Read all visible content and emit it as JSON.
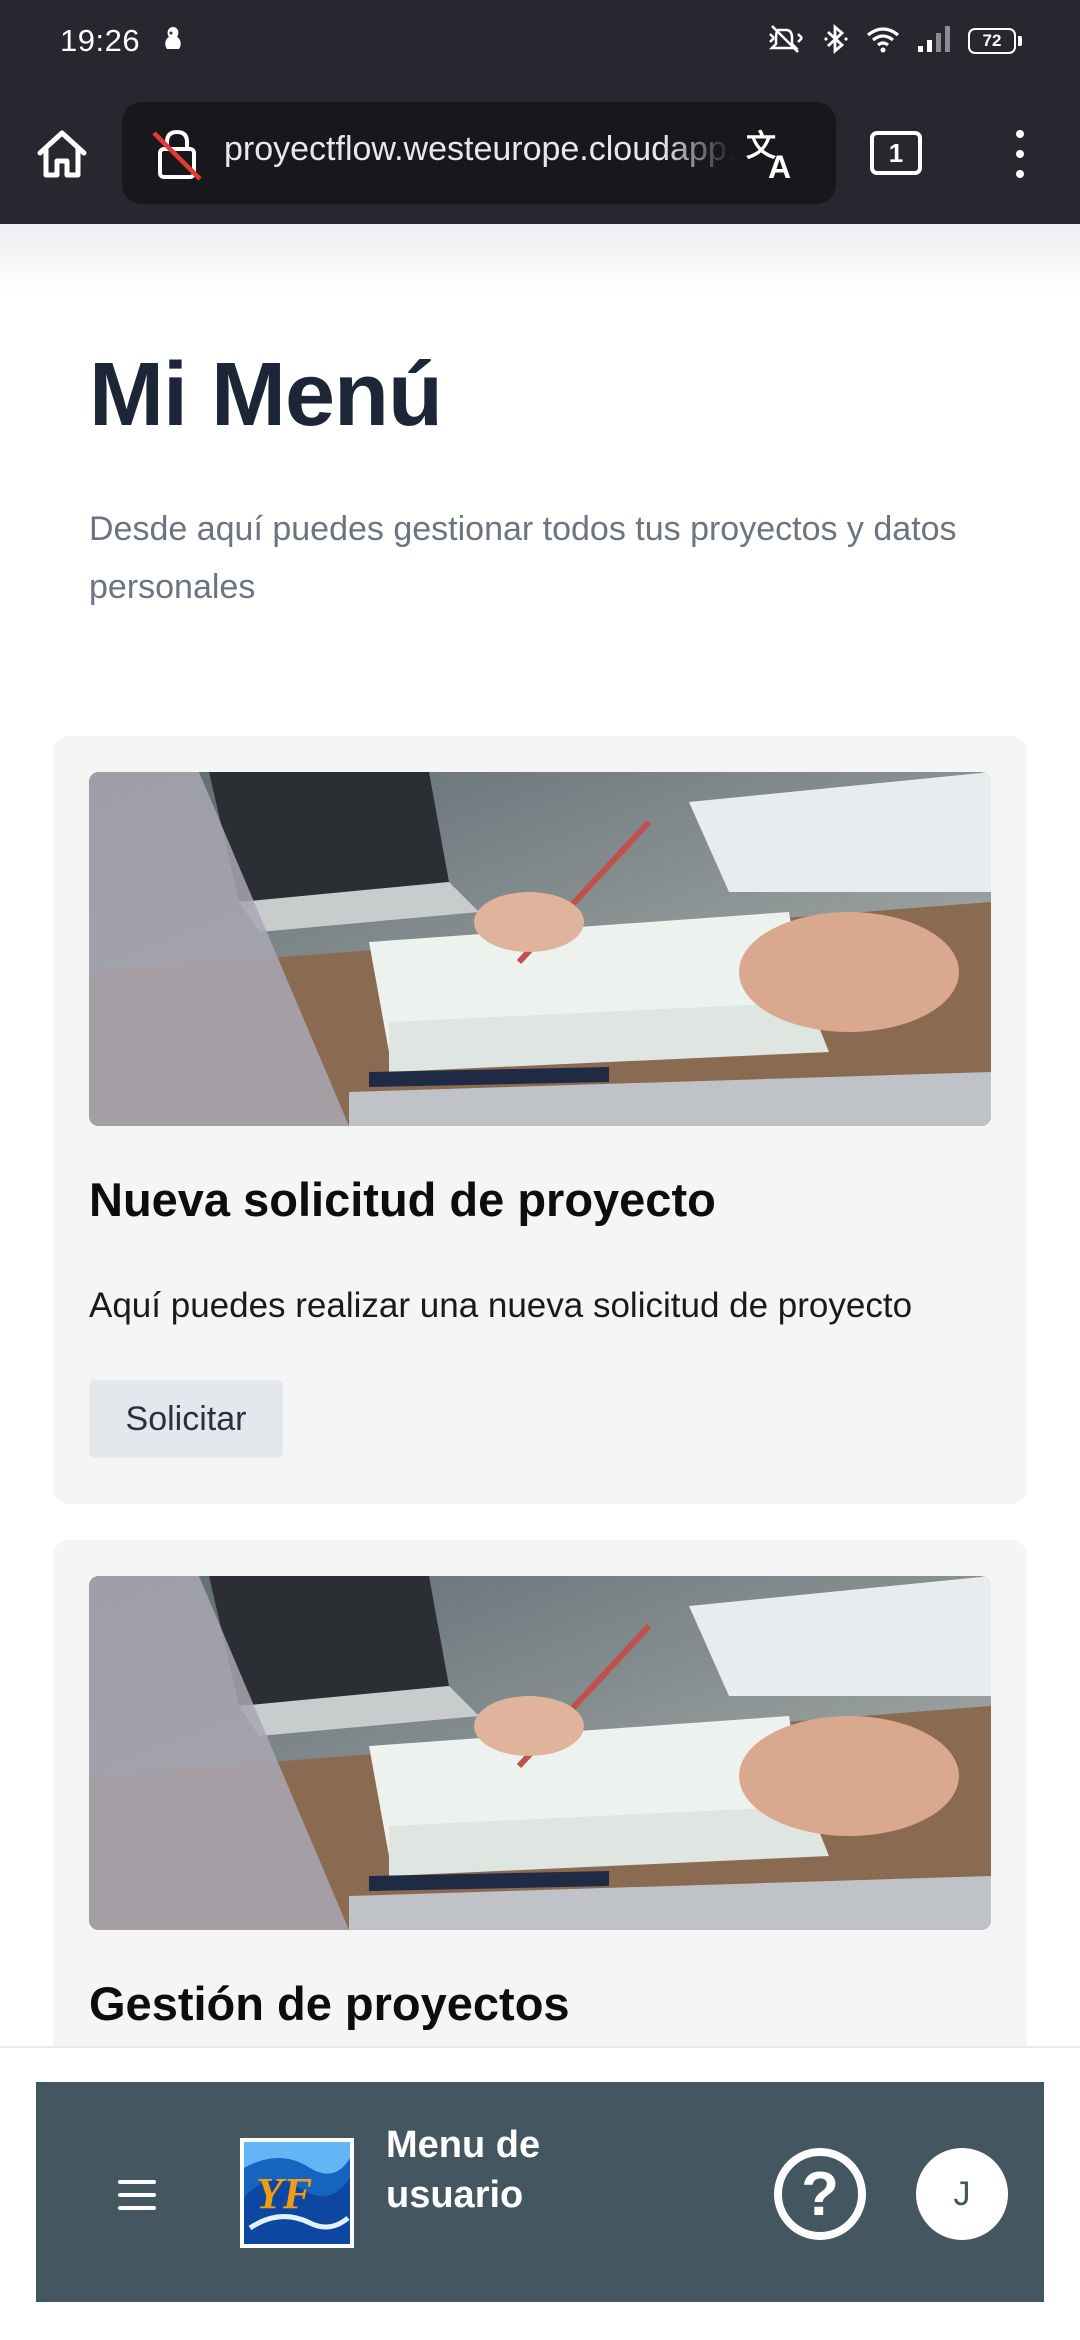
{
  "status_bar": {
    "time": "19:26",
    "battery_level": "72",
    "icons": [
      "silent-mode-icon",
      "bluetooth-icon",
      "wifi-icon",
      "signal-icon",
      "battery-icon"
    ]
  },
  "browser": {
    "url": "proyectflow.westeurope.cloudapp.azure.com",
    "tab_count": "1"
  },
  "page": {
    "title": "Mi Menú",
    "subtitle": "Desde aquí puedes gestionar todos tus proyectos y datos personales"
  },
  "cards": [
    {
      "title": "Nueva solicitud de proyecto",
      "description": "Aquí puedes realizar una nueva solicitud de proyecto",
      "button_label": "Solicitar"
    },
    {
      "title": "Gestión de proyectos"
    }
  ],
  "app_bar": {
    "title": "Menu de usuario",
    "help_label": "?",
    "avatar_initial": "J",
    "logo_letters": "YF"
  },
  "colors": {
    "app_bar": "#44565f",
    "card_bg": "#f5f5f6",
    "title": "#1c2636",
    "browser_bar": "#272730"
  }
}
